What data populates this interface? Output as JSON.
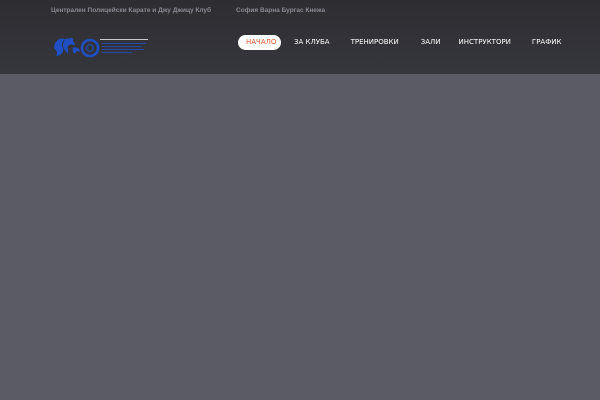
{
  "topbar": {
    "club_name": "Централен Полицейски Карате и Джу Джицу Клуб",
    "cities": "София Варна Бургас Кнежа"
  },
  "logo": {
    "icon": "club-logo-icon",
    "color": "#1f4fc2"
  },
  "nav": {
    "items": [
      {
        "label": "НАЧАЛО",
        "active": true
      },
      {
        "label": "ЗА КЛУБА"
      },
      {
        "label": "ТРЕНИРОВКИ"
      },
      {
        "label": "ЗАЛИ"
      },
      {
        "label": "ИНСТРУКТОРИ"
      },
      {
        "label": "ГРАФИК"
      }
    ],
    "active_color": "#e05a2c"
  },
  "colors": {
    "header_bg": "#2d2d32",
    "hero_bg": "#5b5b66",
    "nav_text": "#ffffff"
  }
}
